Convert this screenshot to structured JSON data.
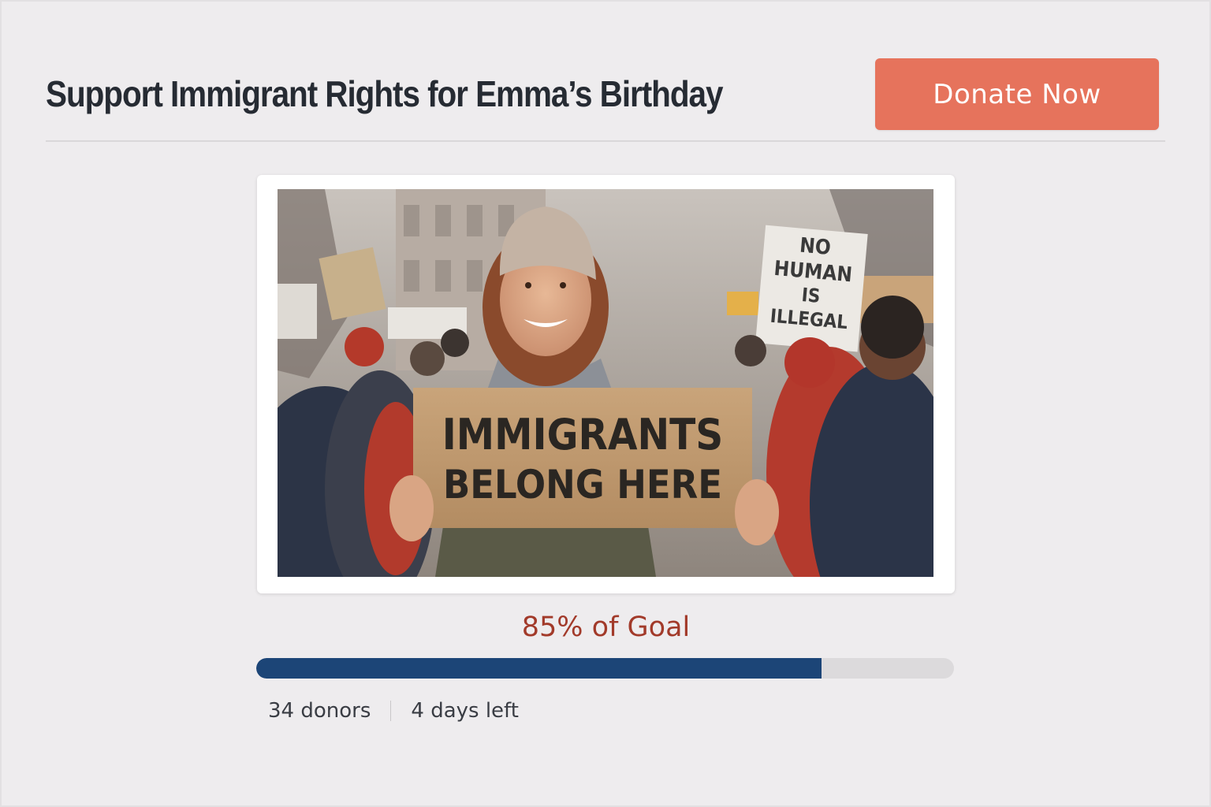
{
  "header": {
    "title": "Support Immigrant Rights for Emma’s Birthday",
    "donate_label": "Donate Now"
  },
  "photo": {
    "sign_main_line1": "IMMIGRANTS",
    "sign_main_line2": "BELONG HERE",
    "sign_back_lines": [
      "NO",
      "HUMAN",
      "IS",
      "ILLEGAL"
    ]
  },
  "progress": {
    "label": "85% of Goal",
    "percent": 81
  },
  "stats": {
    "donors": "34 donors",
    "days_left": "4 days left"
  },
  "colors": {
    "accent": "#e6735c",
    "progress_fill": "#1c4577",
    "progress_text": "#a23a2a"
  }
}
